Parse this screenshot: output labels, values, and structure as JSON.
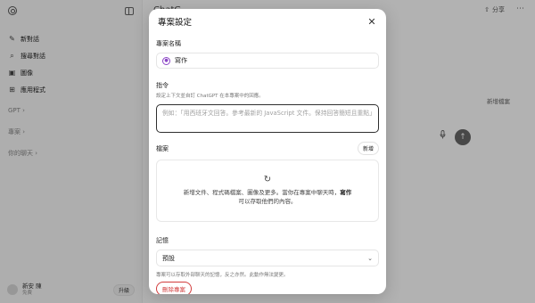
{
  "sidebar": {
    "items": [
      {
        "icon": "new-chat-icon",
        "glyph": "✎",
        "label": "新對話"
      },
      {
        "icon": "search-icon",
        "glyph": "⌕",
        "label": "搜尋對話"
      },
      {
        "icon": "image-icon",
        "glyph": "▣",
        "label": "圖像"
      },
      {
        "icon": "apps-icon",
        "glyph": "⊞",
        "label": "應用程式"
      }
    ],
    "sections": [
      "GPT ›",
      "專案 ›",
      "你的聊天 ›"
    ],
    "user": {
      "name": "新安 陳",
      "plan": "免費",
      "upgrade": "升級"
    }
  },
  "main": {
    "title": "ChatG",
    "share": "分享",
    "share_icon": "⇧",
    "more_icon": "⋯",
    "add_files": "新增檔案",
    "send_icon": "↑"
  },
  "modal": {
    "title": "專案設定",
    "close_icon": "✕",
    "name_label": "專案名稱",
    "name_value": "寫作",
    "instructions_label": "指令",
    "instructions_help": "設定上下文並自訂 ChatGPT 在本專案中的回應。",
    "instructions_placeholder": "例如：「用西班牙文回答。參考最新的 JavaScript 文件。保持回答簡短且重點」",
    "files_label": "檔案",
    "files_new": "新增",
    "files_text_1": "新增文件、程式碼檔案、圖像及更多。當你在專案中聊天時，",
    "files_text_bold": "寫作",
    "files_text_2": "可以存取他們的內容。",
    "memory_label": "記憶",
    "memory_value": "預設",
    "memory_help": "專案可以存取外部聊天的記憶，反之亦然。此動作無法變更。",
    "delete": "刪除專案",
    "upload_icon": "↻"
  }
}
